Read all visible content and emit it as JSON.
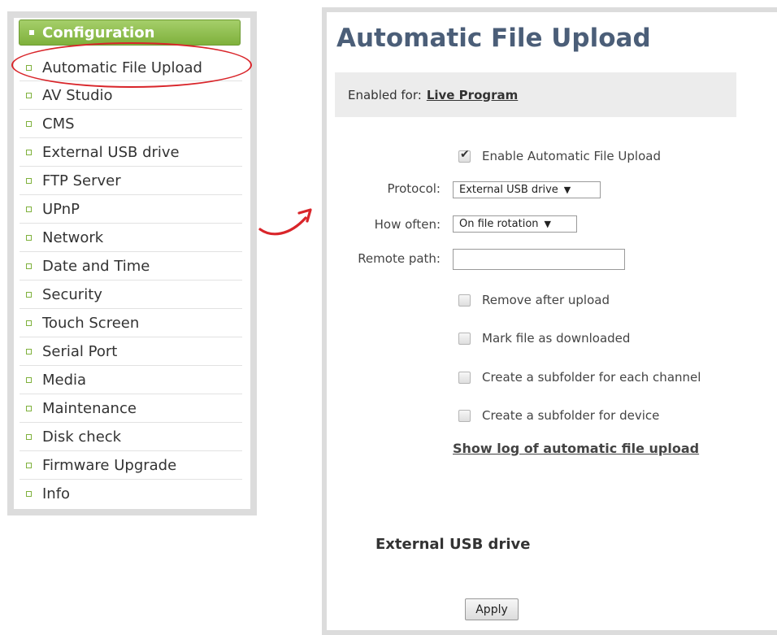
{
  "sidebar": {
    "header": "Configuration",
    "items": [
      {
        "label": "Automatic File Upload"
      },
      {
        "label": "AV Studio"
      },
      {
        "label": "CMS"
      },
      {
        "label": "External USB drive"
      },
      {
        "label": "FTP Server"
      },
      {
        "label": "UPnP"
      },
      {
        "label": "Network"
      },
      {
        "label": "Date and Time"
      },
      {
        "label": "Security"
      },
      {
        "label": "Touch Screen"
      },
      {
        "label": "Serial Port"
      },
      {
        "label": "Media"
      },
      {
        "label": "Maintenance"
      },
      {
        "label": "Disk check"
      },
      {
        "label": "Firmware Upgrade"
      },
      {
        "label": "Info"
      }
    ]
  },
  "main": {
    "title": "Automatic File Upload",
    "enabled_label": "Enabled for:",
    "enabled_value": "Live Program",
    "enable_checkbox": {
      "label": "Enable Automatic File Upload",
      "checked": true
    },
    "protocol": {
      "label": "Protocol:",
      "value": "External USB drive"
    },
    "how_often": {
      "label": "How often:",
      "value": "On file rotation"
    },
    "remote_path": {
      "label": "Remote path:",
      "value": ""
    },
    "options": [
      {
        "label": "Remove after upload",
        "checked": false
      },
      {
        "label": "Mark file as downloaded",
        "checked": false
      },
      {
        "label": "Create a subfolder for each channel",
        "checked": false
      },
      {
        "label": "Create a subfolder for device",
        "checked": false
      }
    ],
    "log_link": "Show log of automatic file upload",
    "section_title": "External USB drive",
    "apply_label": "Apply"
  },
  "colors": {
    "title": "#4b5e78",
    "header_green": "#7fb13c",
    "highlight_red": "#d9252a",
    "panel_border": "#dcdcdc"
  }
}
